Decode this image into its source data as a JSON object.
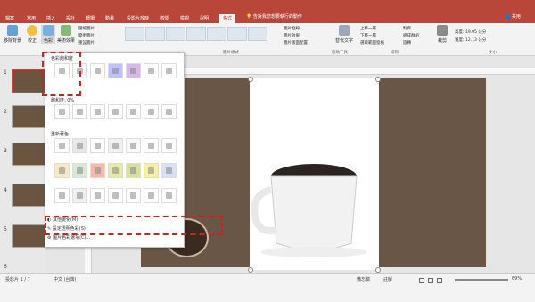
{
  "tabs": [
    "檔案",
    "常用",
    "插入",
    "設計",
    "轉場",
    "動畫",
    "投影片放映",
    "校閱",
    "檢視",
    "說明",
    "格式"
  ],
  "tell_me": "告訴我您想要執行的動作",
  "share": "共用",
  "ribbon": {
    "remove_bg": "移除背景",
    "corrections": "校正",
    "color": "色彩",
    "artistic": "美術效果",
    "compress": "壓縮圖片",
    "change_picture": "變更圖片",
    "reset_picture": "重設圖片",
    "picture_styles_label": "圖片樣式",
    "border": "圖片框線",
    "effects": "圖片效果",
    "layout": "圖片版面配置",
    "alt_text": "替代文字",
    "accessibility_label": "協助工具",
    "bring_forward": "上移一層",
    "send_backward": "下移一層",
    "selection_pane": "選取範圍窗格",
    "align": "對齊",
    "group": "組成群組",
    "rotate": "旋轉",
    "arrange_label": "排列",
    "crop": "裁剪",
    "height_label": "高度:",
    "height_value": "19.05 公分",
    "width_label": "寬度:",
    "width_value": "12.13 公分",
    "size_label": "大小"
  },
  "dropdown": {
    "saturation_title": "色彩飽和度",
    "tone_label": "飽和度: 0%",
    "recolor_title": "重新著色",
    "more_variations": "其他變化(M)",
    "set_transparent": "設定透明色彩(S)",
    "color_options": "圖片色彩選項(C)...",
    "saturation_colors": [
      "#ffffff",
      "#ffffff",
      "#ffffff",
      "#c0c0ff",
      "#d8b8e8",
      "#ffffff",
      "#ffffff"
    ],
    "tone_colors": [
      "#ffffff",
      "#ffffff",
      "#ffffff",
      "#ffffff",
      "#ffffff",
      "#ffffff",
      "#ffffff"
    ],
    "recolor_row1": [
      "#ffffff",
      "#e8e8e8",
      "#ffffff",
      "#f0f0f0",
      "#f8f8f8",
      "#ffffff",
      "#ffffff"
    ],
    "recolor_row2": [
      "#f8e8c8",
      "#d8e8d8",
      "#f8b8a8",
      "#e8e8a8",
      "#d8e0a0",
      "#f8f0a0",
      "#d8e0f8"
    ],
    "recolor_row3": [
      "#ffffff",
      "#f0f0f0",
      "#ffffff",
      "#ffffff",
      "#ffffff",
      "#ffffff",
      "#ffffff"
    ]
  },
  "slides": [
    "1",
    "2",
    "3",
    "4",
    "5",
    "6"
  ],
  "status": {
    "slide_info": "投影片 1 / 7",
    "language": "中文 (台灣)",
    "notes": "備忘稿",
    "comments": "註解",
    "zoom": "69%"
  }
}
